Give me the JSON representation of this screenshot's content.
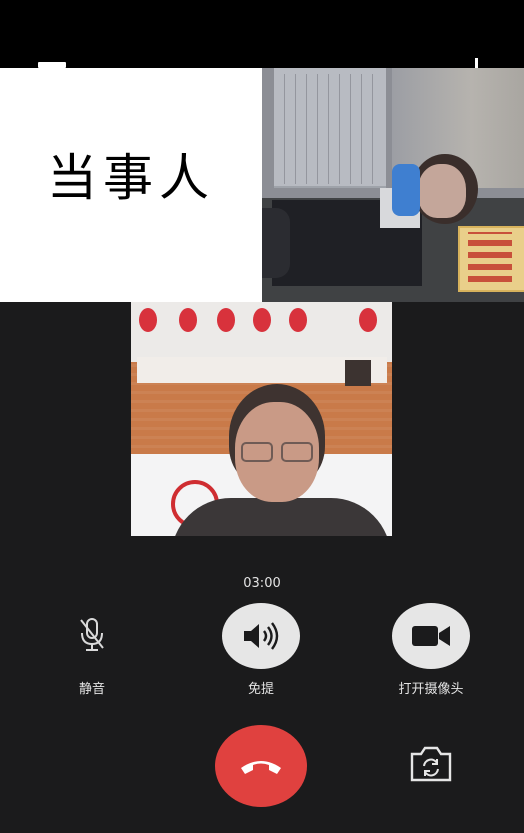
{
  "overlay": {
    "party_label": "当事人"
  },
  "call": {
    "timer": "03:00",
    "controls": {
      "mute": {
        "label": "静音",
        "icon": "microphone-icon"
      },
      "speaker": {
        "label": "免提",
        "icon": "speaker-icon"
      },
      "camera": {
        "label": "打开摄像头",
        "icon": "video-camera-icon"
      }
    },
    "hangup": {
      "icon": "phone-hangup-icon",
      "color": "#e0413f"
    },
    "switch_camera": {
      "icon": "camera-switch-icon"
    },
    "add_participant": {
      "icon": "plus-icon"
    }
  },
  "colors": {
    "background": "#1b1b1c",
    "button_fill": "#e6e6e6",
    "hangup": "#e0413f"
  }
}
